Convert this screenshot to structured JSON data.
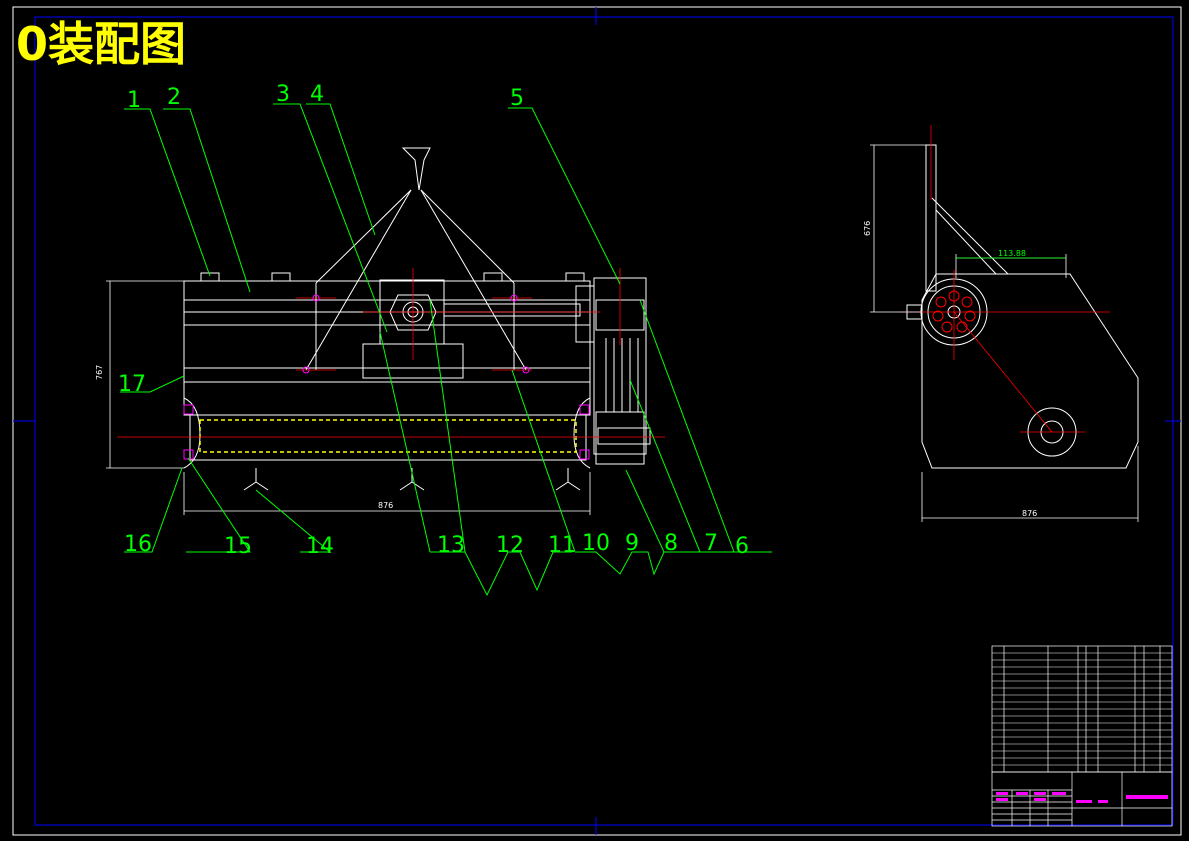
{
  "title": "0装配图",
  "part_numbers": [
    "1",
    "2",
    "3",
    "4",
    "5",
    "17",
    "16",
    "15",
    "14",
    "13",
    "12",
    "11",
    "10",
    "9",
    "8",
    "7",
    "6"
  ],
  "dimensions": {
    "front_height": "767",
    "front_width": "876",
    "side_height": "676",
    "side_offset": "113.88",
    "side_width": "876"
  },
  "colors": {
    "background": "#000000",
    "frame": "#0000ff",
    "outline": "#ffffff",
    "leader": "#00ff00",
    "centerline": "#ff0000",
    "hidden": "#ffff00",
    "title": "#ffff00",
    "label_magenta": "#ff00ff"
  }
}
